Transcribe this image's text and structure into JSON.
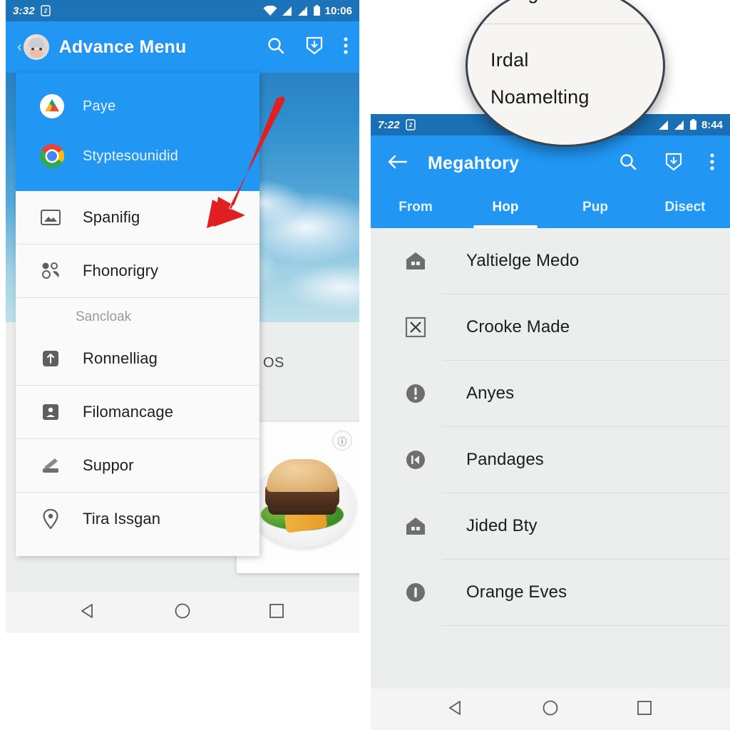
{
  "left_phone": {
    "status_bar": {
      "time": "3:32",
      "left_icon": "sim-card-icon",
      "wifi_icon": "wifi-icon",
      "signal_icon_1": "signal-bars-icon",
      "signal_icon_2": "signal-roaming-icon",
      "battery_icon": "battery-icon",
      "clock": "10:06"
    },
    "app_bar": {
      "back_label": "‹",
      "avatar": "user-avatar",
      "title": "Advance Menu",
      "actions": [
        {
          "name": "search-icon",
          "label": "search"
        },
        {
          "name": "shield-icon",
          "label": "protection"
        },
        {
          "name": "overflow-menu-icon",
          "label": "more"
        }
      ]
    },
    "drawer": {
      "accounts": [
        {
          "icon": "google-drive-icon",
          "label": "Paye"
        },
        {
          "icon": "chrome-icon",
          "label": "Styptesounidid"
        }
      ],
      "items": [
        {
          "icon": "image-frame-icon",
          "label": "Spanifig"
        },
        {
          "icon": "people-group-icon",
          "label": "Fhonorigry"
        }
      ],
      "section_title": "Sancloak",
      "section_items": [
        {
          "icon": "upload-arrow-icon",
          "label": "Ronnelliag"
        },
        {
          "icon": "person-badge-icon",
          "label": "Filomancage"
        },
        {
          "icon": "printer-icon",
          "label": "Suppor"
        },
        {
          "icon": "location-pin-icon",
          "label": "Tira Issgan"
        }
      ]
    },
    "background": {
      "os_text": "l OS",
      "food_card_badge": "ⓘ"
    },
    "nav_bar": {
      "back": "nav-back-icon",
      "home": "nav-home-icon",
      "recent": "nav-recent-icon"
    }
  },
  "right_phone": {
    "status_bar": {
      "time": "7:22",
      "left_icon": "sim-card-icon",
      "signal_icon_1": "signal-bars-icon",
      "signal_icon_2": "signal-roaming-icon",
      "battery_icon": "battery-icon",
      "clock": "8:44"
    },
    "app_bar": {
      "back_label": "←",
      "title": "Megahtory",
      "actions": [
        {
          "name": "search-icon",
          "label": "search"
        },
        {
          "name": "shield-icon",
          "label": "protection"
        },
        {
          "name": "overflow-menu-icon",
          "label": "more"
        }
      ]
    },
    "tabs": [
      {
        "label": "From",
        "active": false
      },
      {
        "label": "Hop",
        "active": true
      },
      {
        "label": "Pup",
        "active": false
      },
      {
        "label": "Disect",
        "active": false
      }
    ],
    "list_items": [
      {
        "icon": "house-icon",
        "label": "Yaltielge Medo"
      },
      {
        "icon": "x-box-icon",
        "label": "Crooke Made"
      },
      {
        "icon": "alert-circle-icon",
        "label": "Anyes"
      },
      {
        "icon": "rewind-circle-icon",
        "label": "Pandages"
      },
      {
        "icon": "house-icon",
        "label": "Jided Bty"
      },
      {
        "icon": "info-circle-icon",
        "label": "Orange Eves"
      }
    ],
    "nav_bar": {
      "back": "nav-back-icon",
      "home": "nav-home-icon",
      "recent": "nav-recent-icon"
    }
  },
  "magnifier": {
    "line_top": "vlenge",
    "line_1": "Irdal",
    "line_2": "Noamelting"
  },
  "annotation": {
    "arrow_color": "#e02020"
  },
  "colors": {
    "primary": "#2196f3",
    "status_bar": "#1d73b8",
    "surface": "#fafafa",
    "list_bg": "#eceded",
    "text": "#1c1c1c",
    "muted": "#9a9a9a"
  }
}
